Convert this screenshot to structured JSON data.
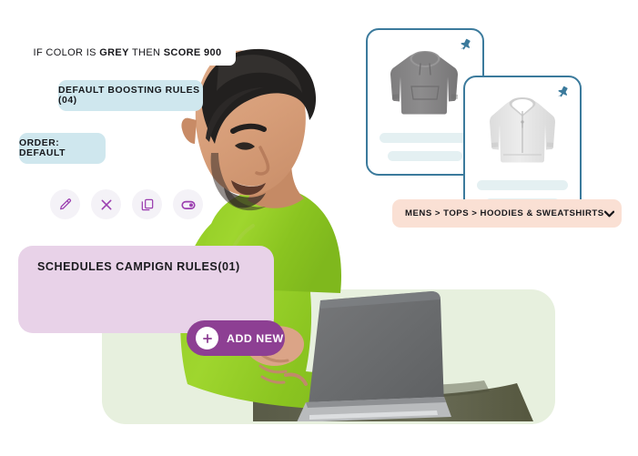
{
  "page": {
    "background": "#ffffff",
    "accent_purple": "#8d3f93",
    "accent_blue": "#3b7a9c",
    "badge_blue": "#cfe7ee",
    "card_lavender": "#e8d2e8",
    "breadcrumb_peach": "#fae0d4",
    "blob_green": "#e7f0de"
  },
  "badges": {
    "boosting_rules": "DEFAULT BOOSTING RULES (04)",
    "order": "ORDER: DEFAULT"
  },
  "icon_toolbar": {
    "items": [
      {
        "name": "edit-icon",
        "label": "Edit"
      },
      {
        "name": "close-icon",
        "label": "Close"
      },
      {
        "name": "duplicate-icon",
        "label": "Duplicate"
      },
      {
        "name": "toggle-icon",
        "label": "Toggle"
      }
    ]
  },
  "rules_card": {
    "title": "SCHEDULES CAMPIGN RULES(01)",
    "rule_prefix": "IF COLOR IS ",
    "rule_value": "GREY",
    "rule_middle": " THEN ",
    "rule_score": "SCORE 900"
  },
  "add_new_button": {
    "label": "ADD NEW",
    "icon": "plus-icon"
  },
  "product_cards": [
    {
      "name": "product-card-grey-hoodie",
      "pin_icon": "pin-icon",
      "product": "grey pullover hoodie",
      "placeholder_lines": 2
    },
    {
      "name": "product-card-light-grey-zip-hoodie",
      "pin_icon": "pin-icon",
      "product": "light grey zip-up hoodie",
      "placeholder_lines": 2
    }
  ],
  "breadcrumb_dropdown": {
    "text": "MENS > TOPS > HOODIES & SWEATSHIRTS",
    "caret_icon": "chevron-down-icon"
  },
  "photo": {
    "description": "man in green sweatshirt using a laptop"
  }
}
